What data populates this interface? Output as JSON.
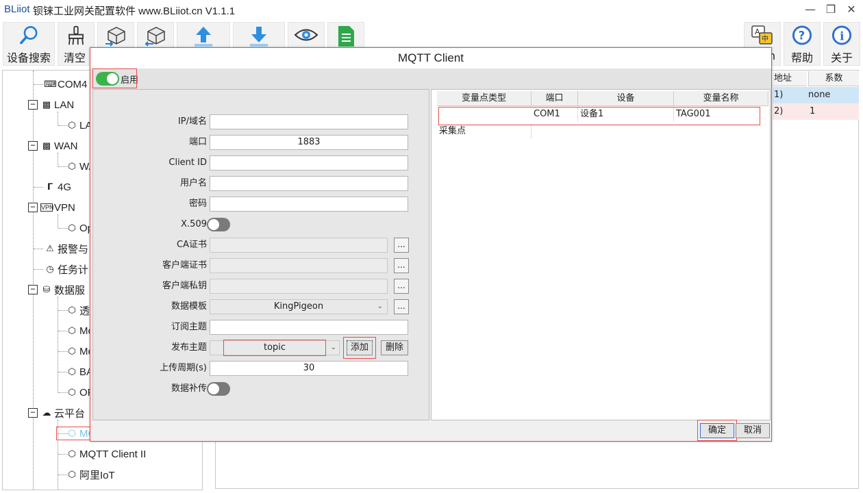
{
  "titlebar": {
    "brand": "BLiiot",
    "title": "钡铼工业网关配置软件 www.BLiiot.cn V1.1.1",
    "minimize_icon": "minimize-icon",
    "restore_icon": "restore-icon",
    "close_icon": "close-icon"
  },
  "toolbar": {
    "device_search": "设备搜索",
    "clear": "清空",
    "help": "帮助",
    "about": "关于"
  },
  "tree": {
    "com4": "COM4",
    "lan": "LAN",
    "lan_child": "LA",
    "wan": "WAN",
    "wan_child": "WA",
    "g4": "4G",
    "vpn": "VPN",
    "vpn_child": "Op",
    "alarm": "报警与",
    "task": "任务计",
    "data_service": "数据服",
    "ds1": "透",
    "ds2": "Mo",
    "ds3": "Mo",
    "ds4": "BA",
    "ds5": "OF",
    "cloud": "云平台",
    "mqtt1": "MC",
    "mqtt2": "MQTT Client II",
    "aliyun": "阿里IoT"
  },
  "background_table": {
    "col_addr": "地址",
    "col_coef": "系数",
    "row1_addr": "1)",
    "row1_coef": "none",
    "row2_addr": "2)",
    "row2_coef": "1",
    "partial_label": "n"
  },
  "dialog": {
    "title": "MQTT Client",
    "enable_label": "启用",
    "enable_on": true,
    "form": {
      "ip_label": "IP/域名",
      "ip_value": "",
      "port_label": "端口",
      "port_value": "1883",
      "clientid_label": "Client ID",
      "clientid_value": "",
      "user_label": "用户名",
      "user_value": "",
      "pwd_label": "密码",
      "pwd_value": "",
      "x509_label": "X.509",
      "ca_label": "CA证书",
      "client_cert_label": "客户端证书",
      "client_key_label": "客户端私钥",
      "template_label": "数据模板",
      "template_value": "KingPigeon",
      "sub_label": "订阅主题",
      "sub_value": "",
      "pub_label": "发布主题",
      "pub_value": "topic",
      "add_btn": "添加",
      "del_btn": "删除",
      "period_label": "上传周期(s)",
      "period_value": "30",
      "resend_label": "数据补传",
      "browse": "..."
    },
    "grid": {
      "headers": [
        "变量点类型",
        "端口",
        "设备",
        "变量名称"
      ],
      "rows": [
        [
          "采集点",
          "COM1",
          "设备1",
          "TAG001"
        ]
      ]
    },
    "ok_btn": "确定",
    "cancel_btn": "取消"
  }
}
